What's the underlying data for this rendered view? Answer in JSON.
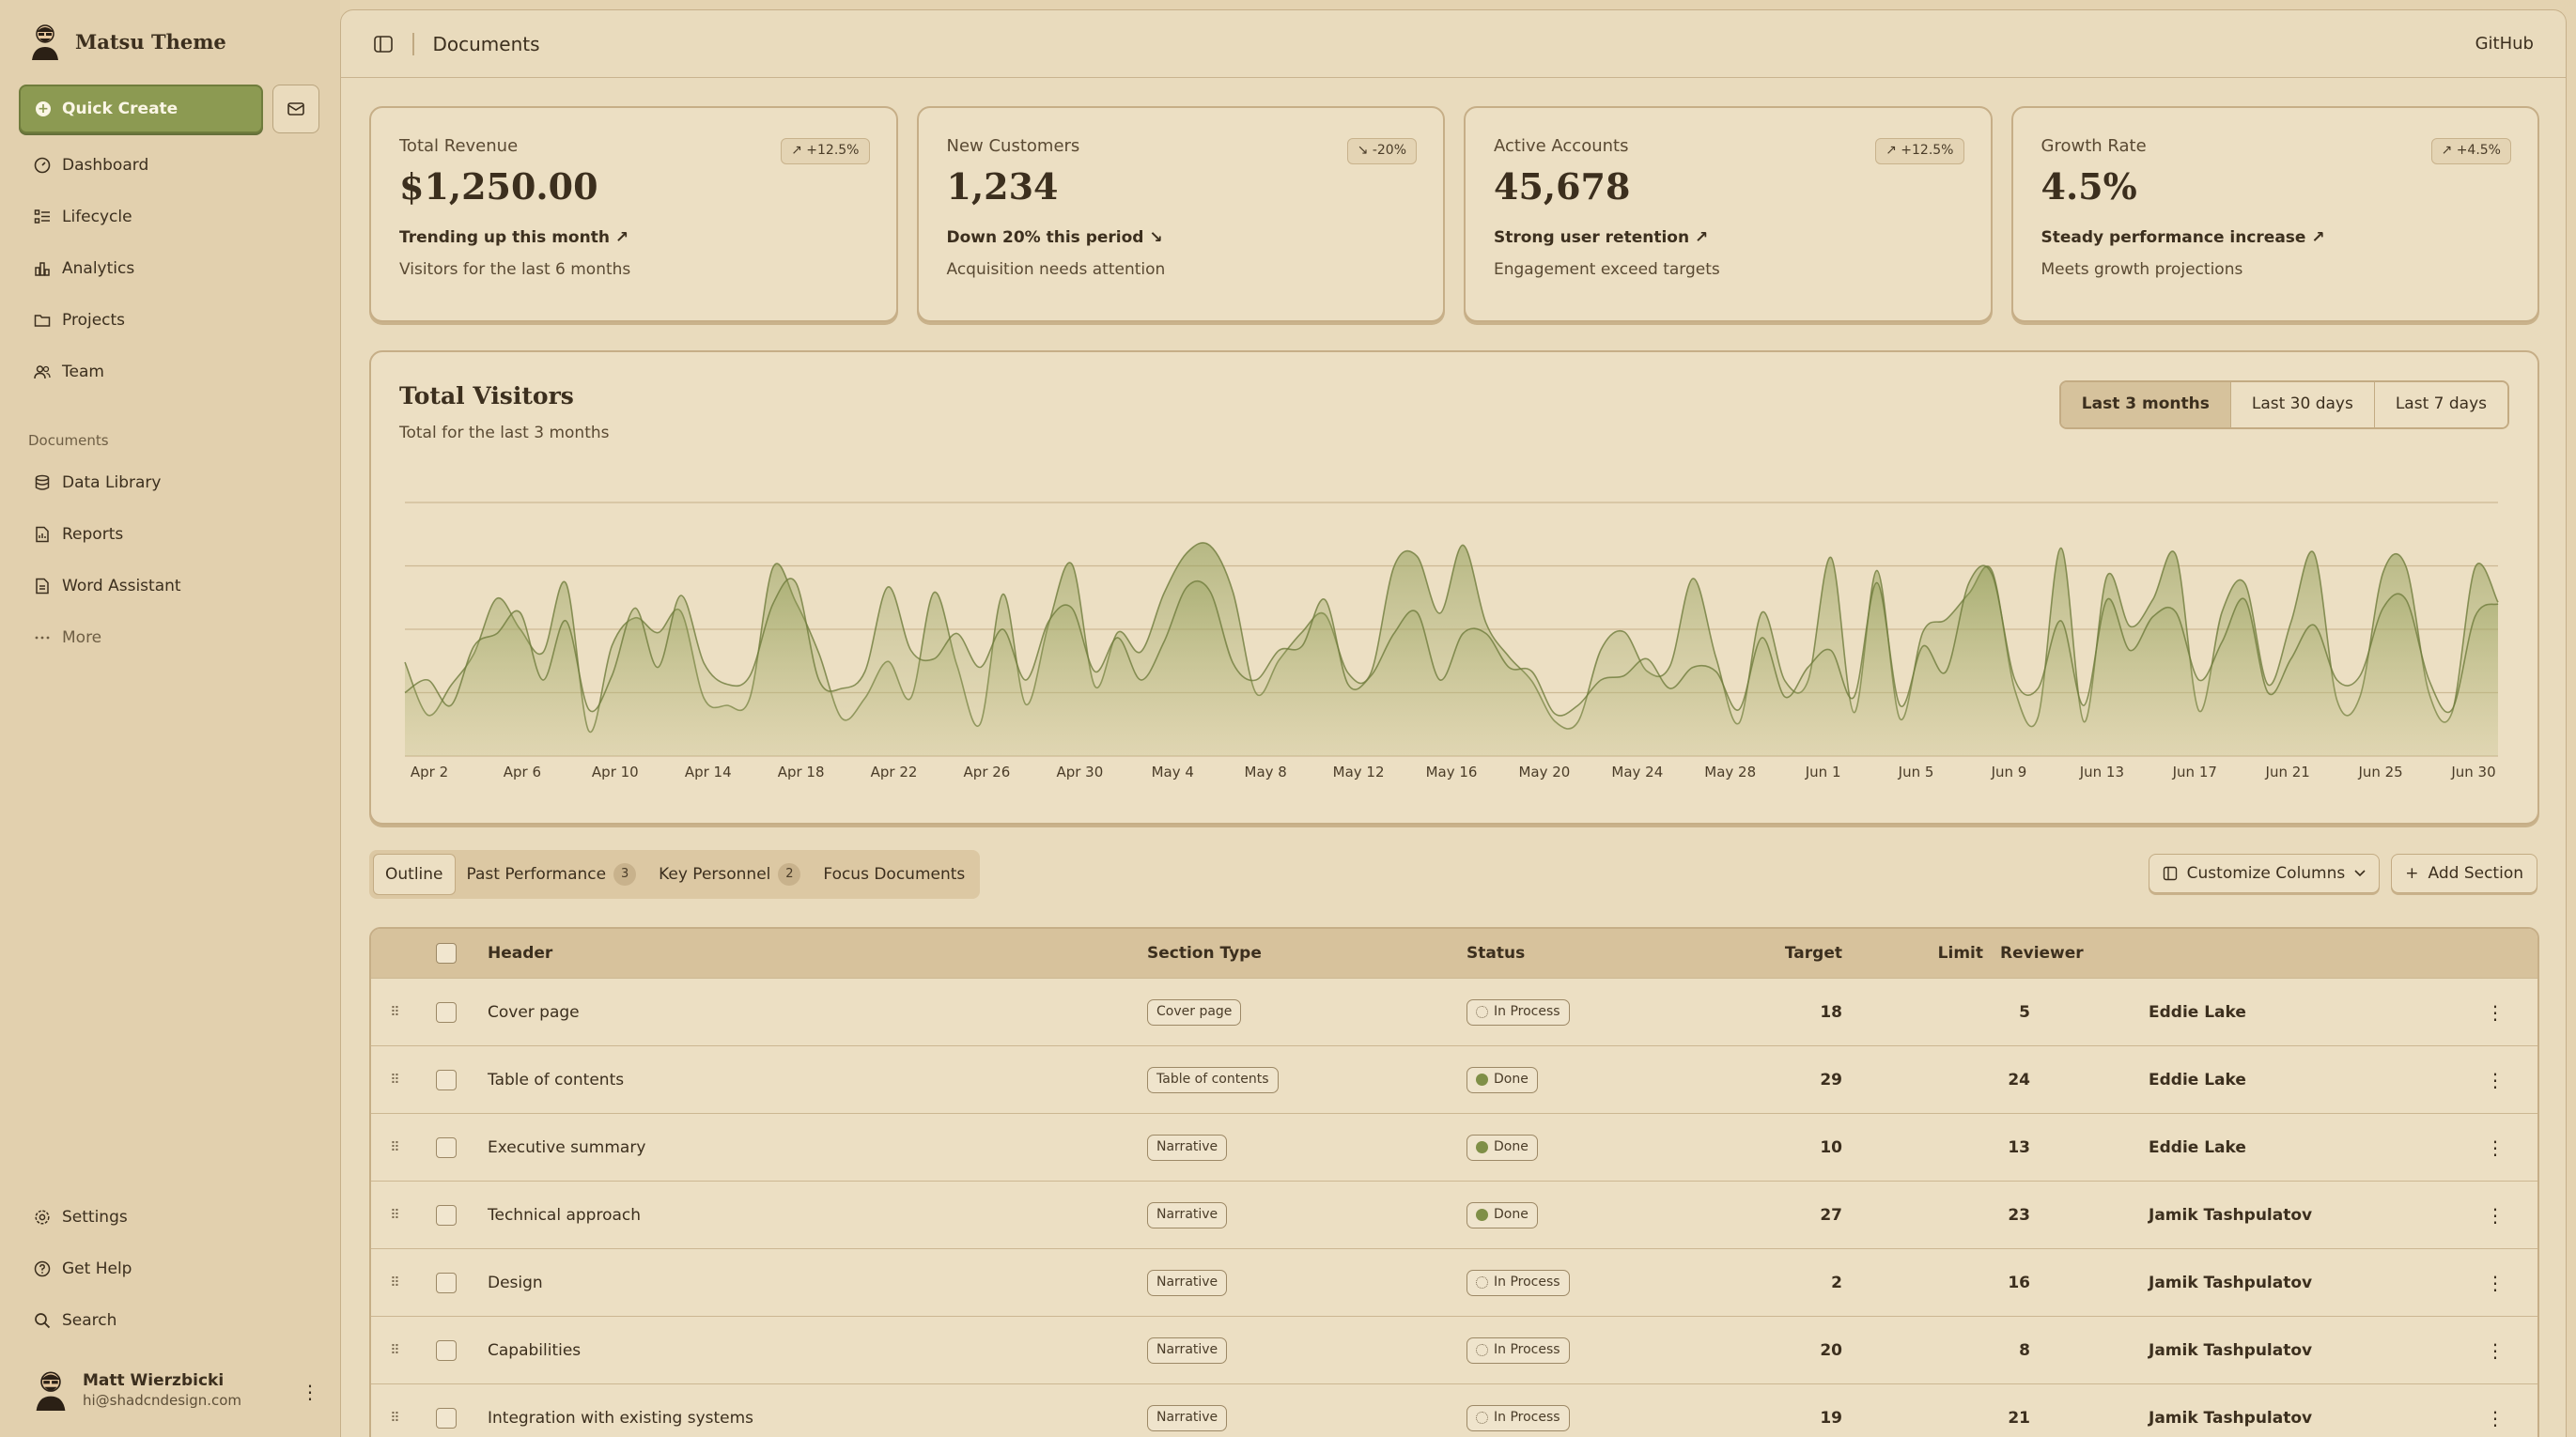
{
  "brand": {
    "name": "Matsu Theme"
  },
  "sidebar": {
    "quick_create": "Quick Create",
    "nav": [
      {
        "label": "Dashboard",
        "icon": "gauge-icon"
      },
      {
        "label": "Lifecycle",
        "icon": "list-icon"
      },
      {
        "label": "Analytics",
        "icon": "bar-chart-icon"
      },
      {
        "label": "Projects",
        "icon": "folder-icon"
      },
      {
        "label": "Team",
        "icon": "users-icon"
      }
    ],
    "documents_label": "Documents",
    "documents": [
      {
        "label": "Data Library",
        "icon": "database-icon"
      },
      {
        "label": "Reports",
        "icon": "report-icon"
      },
      {
        "label": "Word Assistant",
        "icon": "file-word-icon"
      },
      {
        "label": "More",
        "icon": "ellipsis-icon"
      }
    ],
    "bottom": [
      {
        "label": "Settings",
        "icon": "gear-icon"
      },
      {
        "label": "Get Help",
        "icon": "help-icon"
      },
      {
        "label": "Search",
        "icon": "search-icon"
      }
    ],
    "user": {
      "name": "Matt Wierzbicki",
      "email": "hi@shadcndesign.com"
    }
  },
  "header": {
    "title": "Documents",
    "github": "GitHub"
  },
  "cards": [
    {
      "label": "Total Revenue",
      "value": "$1,250.00",
      "badge": "+12.5%",
      "trend": "Trending up this month",
      "sub": "Visitors for the last 6 months",
      "direction": "up"
    },
    {
      "label": "New Customers",
      "value": "1,234",
      "badge": "-20%",
      "trend": "Down 20% this period",
      "sub": "Acquisition needs attention",
      "direction": "down"
    },
    {
      "label": "Active Accounts",
      "value": "45,678",
      "badge": "+12.5%",
      "trend": "Strong user retention",
      "sub": "Engagement exceed targets",
      "direction": "up"
    },
    {
      "label": "Growth Rate",
      "value": "4.5%",
      "badge": "+4.5%",
      "trend": "Steady performance increase",
      "sub": "Meets growth projections",
      "direction": "up"
    }
  ],
  "visitors": {
    "title": "Total Visitors",
    "subtitle": "Total for the last 3 months",
    "ranges": [
      "Last 3 months",
      "Last 30 days",
      "Last 7 days"
    ],
    "active_range": "Last 3 months"
  },
  "chart_data": {
    "type": "area",
    "title": "Total Visitors",
    "x_tick_labels": [
      "Apr 2",
      "Apr 6",
      "Apr 10",
      "Apr 14",
      "Apr 18",
      "Apr 22",
      "Apr 26",
      "Apr 30",
      "May 4",
      "May 8",
      "May 12",
      "May 16",
      "May 20",
      "May 24",
      "May 28",
      "Jun 1",
      "Jun 5",
      "Jun 9",
      "Jun 13",
      "Jun 17",
      "Jun 21",
      "Jun 25",
      "Jun 30"
    ],
    "grid": true,
    "series": [
      {
        "values": [
          222,
          97,
          167,
          242,
          373,
          301,
          245,
          409,
          59,
          261,
          327,
          292,
          342,
          137,
          120,
          138,
          446,
          364,
          243,
          89,
          137,
          224,
          138,
          387,
          215,
          75,
          383,
          122,
          315,
          454,
          165,
          293,
          247,
          385,
          481,
          498,
          388,
          149,
          227,
          293,
          335,
          197,
          197,
          448,
          473,
          338,
          499,
          315,
          235,
          177,
          82,
          81,
          252,
          294,
          201,
          213,
          420,
          233,
          78,
          340,
          178,
          178,
          470,
          103,
          439,
          88,
          294,
          323,
          385,
          438,
          155,
          92,
          492,
          81,
          426,
          307,
          371,
          475,
          107,
          341,
          408,
          169,
          317,
          480,
          132,
          141,
          434,
          448,
          149,
          103,
          446,
          364
        ]
      },
      {
        "values": [
          150,
          180,
          120,
          260,
          290,
          340,
          180,
          320,
          110,
          190,
          350,
          210,
          380,
          220,
          170,
          190,
          360,
          410,
          180,
          160,
          200,
          400,
          250,
          230,
          290,
          210,
          300,
          180,
          320,
          350,
          200,
          280,
          180,
          270,
          400,
          390,
          220,
          180,
          250,
          260,
          370,
          170,
          190,
          290,
          340,
          180,
          290,
          290,
          210,
          200,
          100,
          120,
          180,
          190,
          230,
          160,
          210,
          200,
          110,
          280,
          140,
          210,
          250,
          140,
          410,
          120,
          260,
          200,
          410,
          430,
          180,
          160,
          320,
          120,
          370,
          250,
          330,
          340,
          180,
          270,
          370,
          150,
          230,
          310,
          180,
          190,
          350,
          370,
          180,
          110,
          330,
          360
        ]
      }
    ]
  },
  "table_tabs": [
    {
      "label": "Outline",
      "count": ""
    },
    {
      "label": "Past Performance",
      "count": "3"
    },
    {
      "label": "Key Personnel",
      "count": "2"
    },
    {
      "label": "Focus Documents",
      "count": ""
    }
  ],
  "table_actions": {
    "customize": "Customize Columns",
    "add": "Add Section"
  },
  "table": {
    "columns": [
      "Header",
      "Section Type",
      "Status",
      "Target",
      "Limit",
      "Reviewer"
    ],
    "rows": [
      {
        "header": "Cover page",
        "type": "Cover page",
        "status": "In Process",
        "target": "18",
        "limit": "5",
        "reviewer": "Eddie Lake"
      },
      {
        "header": "Table of contents",
        "type": "Table of contents",
        "status": "Done",
        "target": "29",
        "limit": "24",
        "reviewer": "Eddie Lake"
      },
      {
        "header": "Executive summary",
        "type": "Narrative",
        "status": "Done",
        "target": "10",
        "limit": "13",
        "reviewer": "Eddie Lake"
      },
      {
        "header": "Technical approach",
        "type": "Narrative",
        "status": "Done",
        "target": "27",
        "limit": "23",
        "reviewer": "Jamik Tashpulatov"
      },
      {
        "header": "Design",
        "type": "Narrative",
        "status": "In Process",
        "target": "2",
        "limit": "16",
        "reviewer": "Jamik Tashpulatov"
      },
      {
        "header": "Capabilities",
        "type": "Narrative",
        "status": "In Process",
        "target": "20",
        "limit": "8",
        "reviewer": "Jamik Tashpulatov"
      },
      {
        "header": "Integration with existing systems",
        "type": "Narrative",
        "status": "In Process",
        "target": "19",
        "limit": "21",
        "reviewer": "Jamik Tashpulatov"
      }
    ]
  },
  "colors": {
    "accent": "#8c9a52",
    "background": "#e4d3b1",
    "panel": "#e9dbbd",
    "text": "#3c2f1e"
  }
}
